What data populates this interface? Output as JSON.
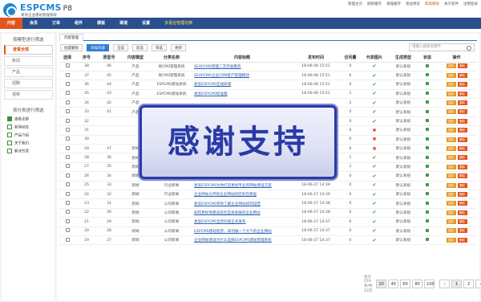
{
  "header": {
    "brand": "ESPCMS",
    "version": "P8",
    "subtitle": "易思企业建站管理系统",
    "top_links": [
      "管理主页",
      "刷新缓存",
      "清理缓存",
      "现站预览",
      "帮助教程",
      "关于软件",
      "注销登录"
    ],
    "menu": [
      "内容",
      "会员",
      "订单",
      "组件",
      "模板",
      "渠道",
      "设置"
    ],
    "language_link": "多语言管理切换"
  },
  "sidebar": {
    "section1_title": "按模型进行筛选",
    "models": [
      "查看全部",
      "新闻",
      "产品",
      "招聘",
      "视频"
    ],
    "section2_title": "按分类进行筛选",
    "categories": [
      "查看全部",
      "新闻动态",
      "产品介绍",
      "关于我们",
      "解决方案"
    ]
  },
  "main": {
    "tab": "内容管理",
    "toolbar": [
      "批量删除",
      "添加内容",
      "全选",
      "反选",
      "筛选",
      "更新"
    ],
    "search_placeholder": "请输入搜索关键字",
    "columns": [
      "选择",
      "序号",
      "原型号",
      "内容模型",
      "分类名称",
      "内容标题",
      "发布时间",
      "访问量",
      "代表图片",
      "生成类型",
      "状态",
      "操作"
    ],
    "rows": [
      {
        "seq": "38",
        "orig": "46",
        "model": "产品",
        "cat": "易CMS管理系统",
        "title": "SEAPCMS管理二次开发服务",
        "date": "18-06-08 15:51",
        "views": "0",
        "img": "ok",
        "gen": "默认系统"
      },
      {
        "seq": "37",
        "orig": "45",
        "model": "产品",
        "cat": "易CMS管理系统",
        "title": "SEAPCMS企业CRM客户管理模块",
        "date": "18-06-08 15:51",
        "views": "0",
        "img": "ok",
        "gen": "默认系统"
      },
      {
        "seq": "36",
        "orig": "44",
        "model": "产品",
        "cat": "ESPCMS建站系统",
        "title": "易思ESPCMS在线商城",
        "date": "18-06-08 15:51",
        "views": "0",
        "img": "ok",
        "gen": "默认系统"
      },
      {
        "seq": "35",
        "orig": "43",
        "model": "产品",
        "cat": "ESPCMS建站系统",
        "title": "易思ESPCMS标准版",
        "date": "18-06-08 15:51",
        "views": "1",
        "img": "ok",
        "gen": "默认系统"
      },
      {
        "seq": "34",
        "orig": "42",
        "model": "产品",
        "cat": "",
        "title": "",
        "date": "",
        "views": "2",
        "img": "ok",
        "gen": "默认系统"
      },
      {
        "seq": "33",
        "orig": "41",
        "model": "产品",
        "cat": "",
        "title": "",
        "date": "",
        "views": "0",
        "img": "ok",
        "gen": "默认系统"
      },
      {
        "seq": "32",
        "orig": "",
        "model": "",
        "cat": "",
        "title": "",
        "date": "",
        "views": "0",
        "img": "ok",
        "gen": "默认系统"
      },
      {
        "seq": "31",
        "orig": "",
        "model": "",
        "cat": "",
        "title": "",
        "date": "",
        "views": "0",
        "img": "no",
        "gen": "默认系统"
      },
      {
        "seq": "30",
        "orig": "",
        "model": "",
        "cat": "",
        "title": "",
        "date": "",
        "views": "0",
        "img": "no",
        "gen": "默认系统"
      },
      {
        "seq": "29",
        "orig": "47",
        "model": "新闻",
        "cat": "行业新闻",
        "title": "2019年，网站建设重要的三大趋势，你准备好了吗",
        "date": "18-06-27 14:37",
        "views": "0",
        "img": "no",
        "gen": "默认系统"
      },
      {
        "seq": "28",
        "orig": "36",
        "model": "新闻",
        "cat": "行业新闻",
        "title": "如何快速开发网页并提高转化率，试看看这几个建议",
        "date": "18-06-27 14:41",
        "views": "1",
        "img": "ok",
        "gen": "默认系统"
      },
      {
        "seq": "27",
        "orig": "35",
        "model": "新闻",
        "cat": "行业新闻",
        "title": "你是否使用过易思独享的ESPCMS建站程序",
        "date": "18-06-27 14:40",
        "views": "1",
        "img": "ok",
        "gen": "默认系统"
      },
      {
        "seq": "26",
        "orig": "34",
        "model": "新闻",
        "cat": "行业新闻",
        "title": "易思ESPCMS网站模板的与常见问题讲解",
        "date": "18-06-27 14:40",
        "views": "0",
        "img": "ok",
        "gen": "默认系统"
      },
      {
        "seq": "25",
        "orig": "33",
        "model": "新闻",
        "cat": "行业新闻",
        "title": "易思ESPCMS为你打造更加专业的网站建设方案",
        "date": "18-06-27 14:39",
        "views": "0",
        "img": "ok",
        "gen": "默认系统"
      },
      {
        "seq": "24",
        "orig": "32",
        "model": "新闻",
        "cat": "行业新闻",
        "title": "企业网站与传统企业网站的区别在哪里",
        "date": "18-06-27 14:39",
        "views": "0",
        "img": "ok",
        "gen": "默认系统"
      },
      {
        "seq": "23",
        "orig": "31",
        "model": "新闻",
        "cat": "公司新闻",
        "title": "易思ESPCMS带你了解企业网站如何运营",
        "date": "18-06-27 14:38",
        "views": "0",
        "img": "ok",
        "gen": "默认系统"
      },
      {
        "seq": "22",
        "orig": "30",
        "model": "新闻",
        "cat": "公司新闻",
        "title": "如何更好地建设适合自身发展的企业网站",
        "date": "18-06-27 14:38",
        "views": "0",
        "img": "ok",
        "gen": "默认系统"
      },
      {
        "seq": "21",
        "orig": "29",
        "model": "新闻",
        "cat": "公司新闻",
        "title": "易思ESPCMS全新升级正式发布",
        "date": "18-06-27 14:37",
        "views": "0",
        "img": "ok",
        "gen": "默认系统"
      },
      {
        "seq": "20",
        "orig": "28",
        "model": "新闻",
        "cat": "公司新闻",
        "title": "ESPCMS建站程序，如何做一个大气的企业网站",
        "date": "18-06-27 14:37",
        "views": "0",
        "img": "ok",
        "gen": "默认系统"
      },
      {
        "seq": "19",
        "orig": "27",
        "model": "新闻",
        "cat": "公司新闻",
        "title": "企业网站建设为什么选择ESPCMS建站管理系统",
        "date": "18-06-27 14:37",
        "views": "0",
        "img": "ok",
        "gen": "默认系统"
      }
    ],
    "row_actions": [
      "复制",
      "删除"
    ]
  },
  "pager": {
    "summary": "合计219条/共22页",
    "sizes": [
      "20",
      "40",
      "60",
      "80",
      "100"
    ],
    "pages": [
      "1",
      "2"
    ],
    "next": "›"
  },
  "overlay": {
    "banner_text": "感谢支持"
  }
}
